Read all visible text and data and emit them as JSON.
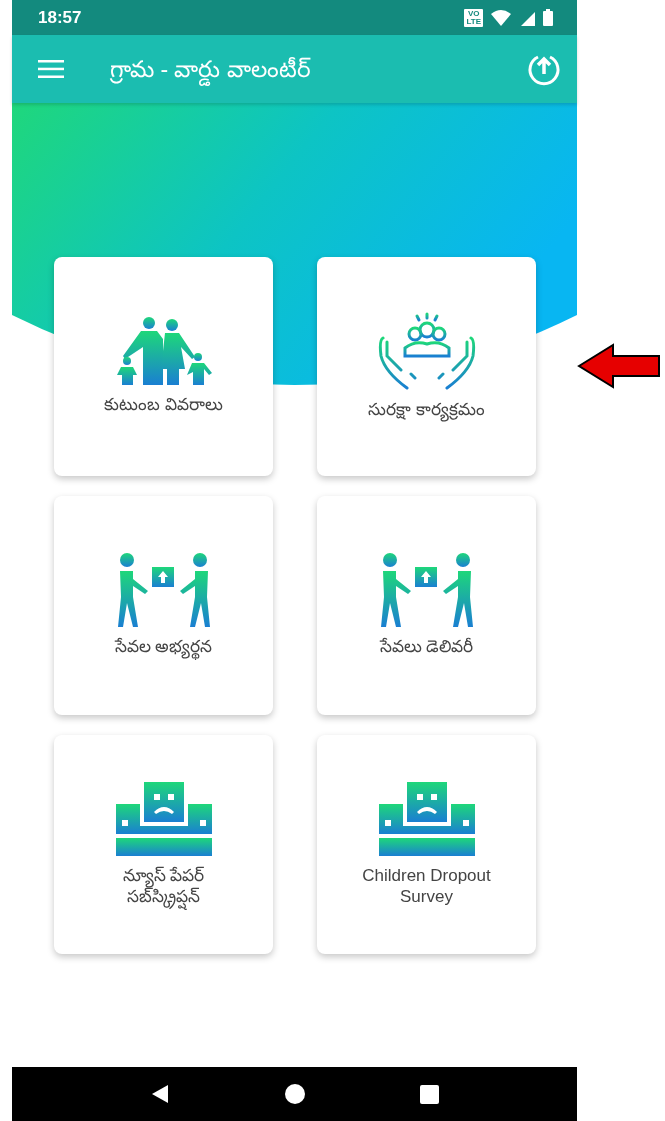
{
  "status_bar": {
    "time": "18:57",
    "network_badge": "VO\nLTE"
  },
  "app_bar": {
    "title": "గ్రామ - వార్డు వాలంటీర్"
  },
  "tiles": [
    {
      "kind": "family",
      "label": "కుటుంబ వివరాలు"
    },
    {
      "kind": "care",
      "label": "సురక్షా కార్యక్రమం"
    },
    {
      "kind": "handover",
      "label": "సేవల అభ్యర్థన"
    },
    {
      "kind": "handover",
      "label": "సేవలు డెలివరీ"
    },
    {
      "kind": "dropout",
      "label": "న్యూస్ పేపర్\nసబ్‌స్క్రిప్షన్"
    },
    {
      "kind": "dropout",
      "label": "Children Dropout\nSurvey"
    }
  ]
}
